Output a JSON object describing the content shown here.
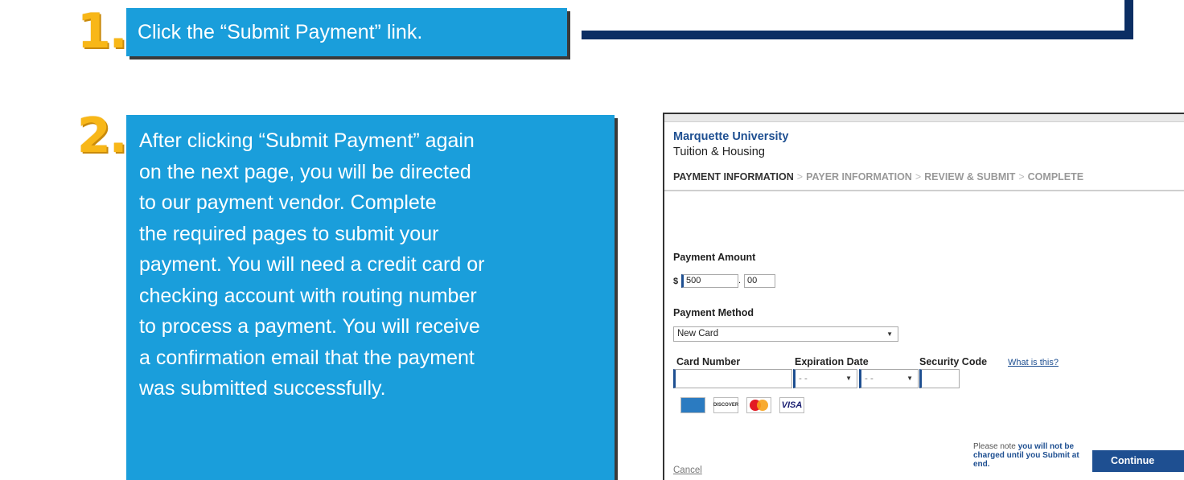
{
  "step1": {
    "number": "1.",
    "text": "Click the “Submit Payment” link."
  },
  "step2": {
    "number": "2.",
    "lines": [
      "After clicking “Submit Payment” again",
      "on the next page, you will be directed",
      "to our payment vendor. Complete",
      "the required pages to submit your",
      "payment. You will need a credit card or",
      "checking account with routing number",
      "to process a payment. You will receive",
      "a confirmation email that the payment",
      "was submitted successfully."
    ]
  },
  "payment_form": {
    "org": "Marquette University",
    "subtitle": "Tuition & Housing",
    "breadcrumbs": [
      "PAYMENT INFORMATION",
      "PAYER INFORMATION",
      "REVIEW & SUBMIT",
      "COMPLETE"
    ],
    "breadcrumb_separator": ">",
    "amount_label": "Payment Amount",
    "currency": "$",
    "amount_dollars": "500",
    "amount_sep": ".",
    "amount_cents": "00",
    "method_label": "Payment Method",
    "method_value": "New Card",
    "card_number_label": "Card Number",
    "expiration_label": "Expiration Date",
    "exp_month": "- -",
    "exp_year": "- -",
    "security_label": "Security Code",
    "whats_this": "What is this?",
    "card_brands": [
      "amex",
      "discover",
      "mastercard",
      "visa"
    ],
    "discover_label": "DISCOVER",
    "visa_label": "VISA",
    "note_prefix": "Please note ",
    "note_bold": "you will not be charged until you Submit at end.",
    "cancel": "Cancel",
    "continue": "Continue"
  },
  "colors": {
    "accent_blue": "#1a9edb",
    "navy": "#0b2e63",
    "step_number": "#f8b718",
    "link_blue": "#1e4f91"
  }
}
